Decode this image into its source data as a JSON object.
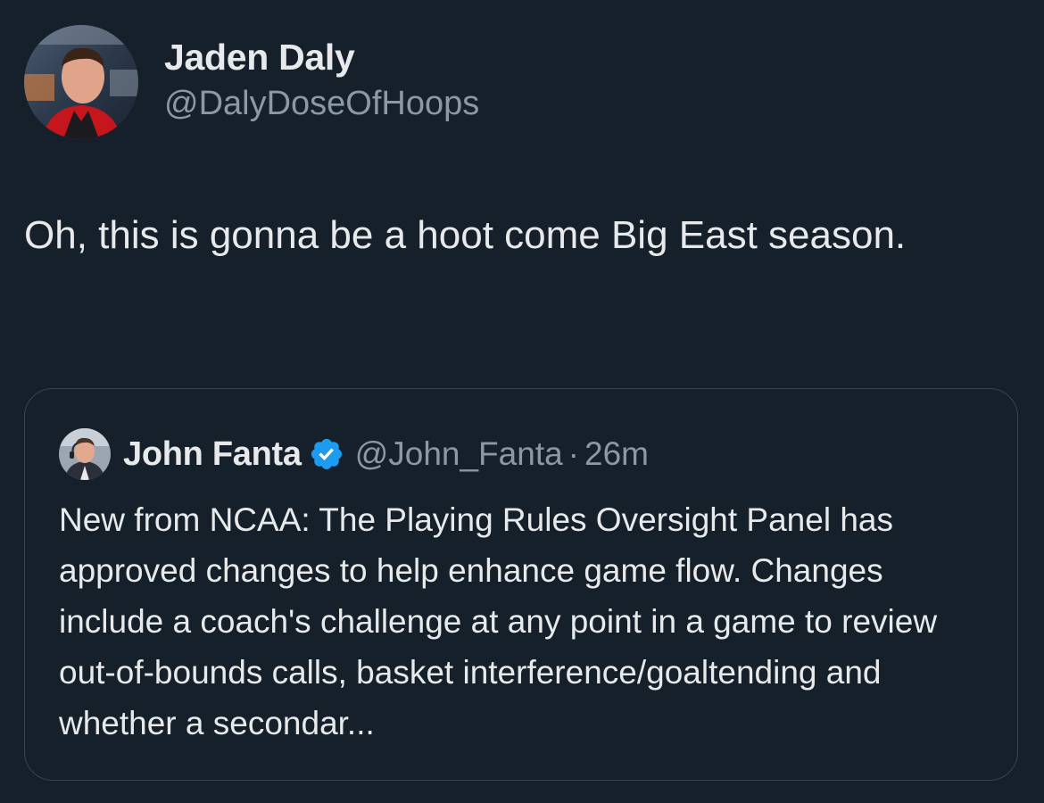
{
  "tweet": {
    "author": {
      "display_name": "Jaden Daly",
      "handle": "@DalyDoseOfHoops"
    },
    "text": "Oh, this is gonna be a hoot come Big East season."
  },
  "quoted_tweet": {
    "author": {
      "display_name": "John Fanta",
      "handle": "@John_Fanta",
      "verified_icon": "verified-badge-icon"
    },
    "separator": "·",
    "time": "26m",
    "text": "New from NCAA: The Playing Rules Oversight Panel has approved changes to help enhance game flow. Changes include a coach's challenge at any point in a game to review out-of-bounds calls, basket interference/goaltending and whether a secondar..."
  },
  "colors": {
    "background": "#15202b",
    "text_primary": "#e7e9ea",
    "text_secondary": "#8b98a5",
    "card_border": "#38444d",
    "verified_blue": "#1d9bf0"
  }
}
